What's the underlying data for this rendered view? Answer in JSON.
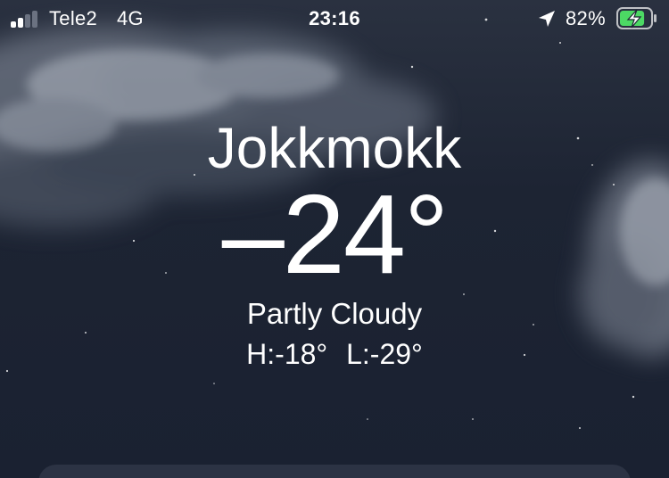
{
  "colors": {
    "signal_active": "#ffffff",
    "signal_inactive": "#6b7281",
    "battery_fill": "#4cd964"
  },
  "status_bar": {
    "carrier": "Tele2",
    "network": "4G",
    "time": "23:16",
    "battery_percent": "82%",
    "battery_level": 0.82,
    "signal_bars_active": 2,
    "signal_bars_total": 4,
    "icons": {
      "signal": "cellular-signal-icon",
      "location": "location-arrow-icon",
      "battery": "battery-charging-icon"
    }
  },
  "weather": {
    "city": "Jokkmokk",
    "temperature": "–24°",
    "condition": "Partly Cloudy",
    "high": "H:-18°",
    "low": "L:-29°"
  }
}
